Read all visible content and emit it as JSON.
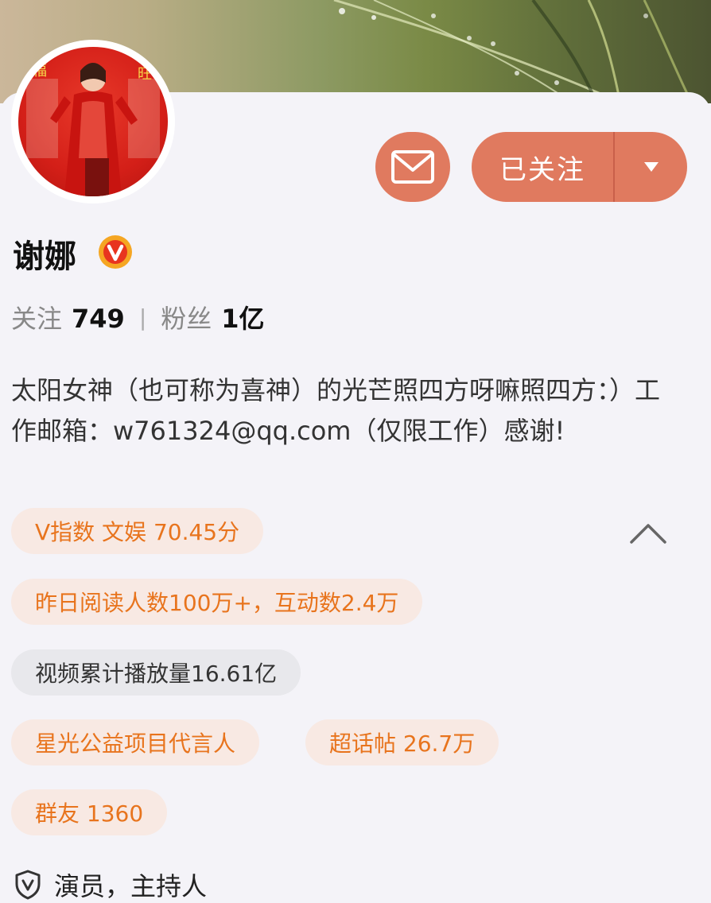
{
  "profile": {
    "name": "谢娜",
    "verified_icon": "verified-v-badge-icon",
    "actions": {
      "message_icon": "mail-icon",
      "follow_label": "已关注",
      "follow_dropdown_icon": "caret-down-icon"
    },
    "stats": {
      "following_label": "关注",
      "following_count": "749",
      "separator": "|",
      "followers_label": "粉丝",
      "followers_count": "1亿"
    },
    "bio": "太阳女神（也可称为喜神）的光芒照四方呀嘛照四方：）工作邮箱：w761324@qq.com（仅限工作）感谢!",
    "tags": [
      {
        "label": "V指数 文娱 70.45分",
        "style": "orange"
      },
      {
        "label": "昨日阅读人数100万+，互动数2.4万",
        "style": "orange"
      },
      {
        "label": "视频累计播放量16.61亿",
        "style": "gray"
      },
      {
        "label": "星光公益项目代言人",
        "style": "orange"
      },
      {
        "label": "超话帖 26.7万",
        "style": "orange"
      },
      {
        "label": "群友 1360",
        "style": "orange"
      }
    ],
    "collapse_icon": "chevron-up-icon",
    "occupation_icon": "shield-v-icon",
    "occupation": "演员，主持人"
  },
  "colors": {
    "accent": "#e07a5f",
    "tag_orange_text": "#e8741d",
    "tag_orange_bg": "#f8e9e3",
    "tag_gray_bg": "#e8e8ec",
    "verified_gold": "#f5a623",
    "verified_red": "#e8341f"
  }
}
